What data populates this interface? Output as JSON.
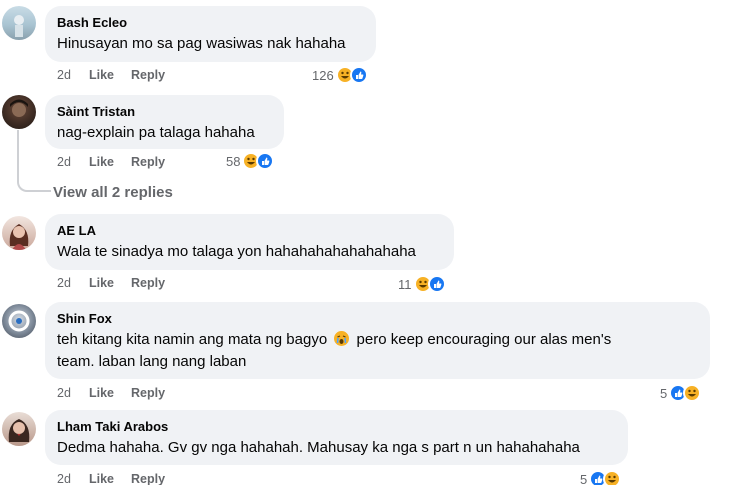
{
  "comments": [
    {
      "author": "Bash Ecleo",
      "text": "Hinusayan mo sa pag wasiwas nak hahaha",
      "time": "2d",
      "like": "Like",
      "reply": "Reply",
      "count": "126",
      "reactions": [
        "haha-icon",
        "like-icon"
      ]
    },
    {
      "author": "Sàint Tristan",
      "text": "nag-explain pa talaga hahaha",
      "time": "2d",
      "like": "Like",
      "reply": "Reply",
      "count": "58",
      "reactions": [
        "haha-icon",
        "like-icon"
      ]
    },
    {
      "author": "AE LA",
      "text": "Wala te sinadya mo talaga yon hahahahahahahahaha",
      "time": "2d",
      "like": "Like",
      "reply": "Reply",
      "count": "11",
      "reactions": [
        "haha-icon",
        "like-icon"
      ]
    },
    {
      "author": "Shin Fox",
      "text": "teh kitang kita namin ang mata ng bagyo",
      "text_after_emoji": "pero keep encouraging our alas men's",
      "text_line2": "team. laban lang nang laban",
      "time": "2d",
      "like": "Like",
      "reply": "Reply",
      "count": "5",
      "reactions": [
        "like-icon",
        "haha-icon"
      ]
    },
    {
      "author": "Lham Taki Arabos",
      "text": "Dedma hahaha. Gv gv nga hahahah. Mahusay ka nga s part n un hahahahaha",
      "time": "2d",
      "like": "Like",
      "reply": "Reply",
      "count": "5",
      "reactions": [
        "like-icon",
        "haha-icon"
      ]
    }
  ],
  "view_replies": "View all 2 replies",
  "colors": {
    "bubble": "#f0f2f5",
    "meta": "#65676b",
    "like_blue": "#1877f2",
    "haha_yellow": "#f7b125"
  }
}
